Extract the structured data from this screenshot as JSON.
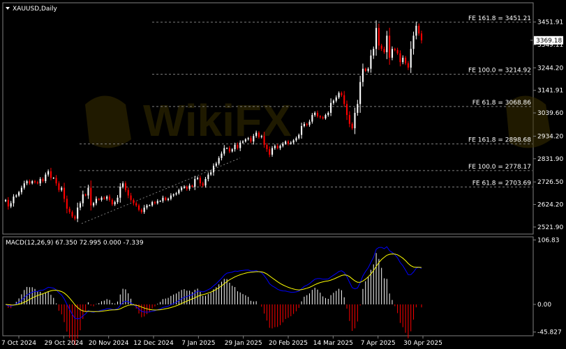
{
  "colors": {
    "background": "#000000",
    "frame": "#808080",
    "bull": "#ffffff",
    "bear": "#ff0000",
    "signal": "#ffff00",
    "macd_line": "#0000ff",
    "hist_pos": "#ffffff",
    "hist_neg": "#ff0000",
    "fib_line": "#808080"
  },
  "chart_data": [
    {
      "type": "candlestick",
      "title": "XAUUSD,Daily",
      "ylim": [
        2490,
        3495
      ],
      "y_ticks": [
        "3451.91",
        "3349.11",
        "3244.20",
        "3141.91",
        "3039.60",
        "2934.20",
        "2831.90",
        "2726.50",
        "2624.20",
        "2521.90"
      ],
      "current_price": "3369.18",
      "x_ticks": [
        "7 Oct 2024",
        "29 Oct 2024",
        "20 Nov 2024",
        "12 Dec 2024",
        "7 Jan 2025",
        "29 Jan 2025",
        "20 Feb 2025",
        "14 Mar 2025",
        "7 Apr 2025",
        "30 Apr 2025"
      ],
      "close": [
        2645,
        2615,
        2630,
        2660,
        2665,
        2680,
        2700,
        2720,
        2730,
        2720,
        2730,
        2725,
        2720,
        2740,
        2730,
        2760,
        2775,
        2745,
        2745,
        2720,
        2690,
        2700,
        2650,
        2605,
        2590,
        2570,
        2560,
        2610,
        2630,
        2670,
        2665,
        2700,
        2620,
        2630,
        2650,
        2645,
        2655,
        2650,
        2660,
        2645,
        2625,
        2635,
        2655,
        2705,
        2720,
        2690,
        2665,
        2645,
        2630,
        2620,
        2600,
        2590,
        2610,
        2620,
        2620,
        2635,
        2630,
        2640,
        2640,
        2655,
        2645,
        2650,
        2665,
        2670,
        2675,
        2690,
        2700,
        2705,
        2695,
        2710,
        2705,
        2740,
        2745,
        2720,
        2710,
        2740,
        2760,
        2770,
        2800,
        2810,
        2835,
        2855,
        2880,
        2880,
        2865,
        2875,
        2895,
        2880,
        2905,
        2910,
        2920,
        2925,
        2910,
        2935,
        2950,
        2930,
        2935,
        2895,
        2875,
        2850,
        2880,
        2890,
        2880,
        2890,
        2900,
        2910,
        2900,
        2905,
        2915,
        2925,
        2940,
        2980,
        2990,
        2985,
        3000,
        3030,
        3040,
        3025,
        3020,
        3015,
        3030,
        3040,
        3085,
        3095,
        3110,
        3130,
        3120,
        3080,
        3030,
        2990,
        2970,
        3040,
        3080,
        3180,
        3240,
        3230,
        3240,
        3300,
        3330,
        3425,
        3345,
        3330,
        3315,
        3390,
        3290,
        3330,
        3325,
        3310,
        3270,
        3290,
        3265,
        3245,
        3330,
        3390,
        3435,
        3400,
        3369
      ],
      "fibonacci": [
        {
          "label": "FE 161.8 = 3451.21",
          "value": 3451.21
        },
        {
          "label": "FE 100.0 = 3214.92",
          "value": 3214.92
        },
        {
          "label": "FE 61.8 = 3068.86",
          "value": 3068.86
        },
        {
          "label": "FE 161.8 = 2898.68",
          "value": 2898.68
        },
        {
          "label": "FE 100.0 = 2778.17",
          "value": 2778.17
        },
        {
          "label": "FE 61.8 = 2703.69",
          "value": 2703.69
        }
      ]
    },
    {
      "type": "macd",
      "label": "MACD(12,26,9) 67.350 72.995 0.000 -7.339",
      "ylim": [
        -52,
        112
      ],
      "y_ticks": [
        "106.83",
        "0.00",
        "-45.827"
      ]
    }
  ],
  "watermark": "WikiFX"
}
